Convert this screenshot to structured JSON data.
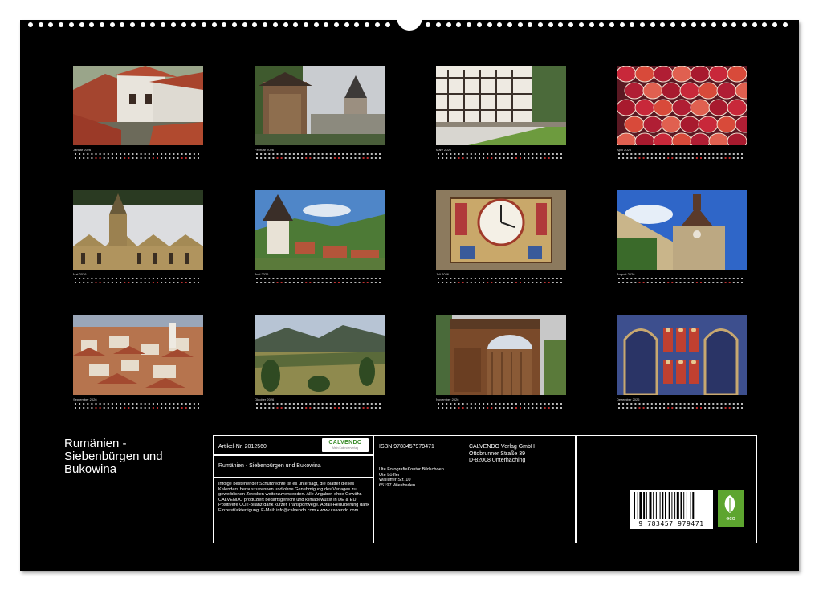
{
  "calendar": {
    "title": "Rumänien - Siebenbürgen und Bukowina",
    "months": [
      {
        "label": "Januar 2026",
        "photo": "castle-courtyard"
      },
      {
        "label": "Februar 2026",
        "photo": "painted-monastery-tower"
      },
      {
        "label": "März 2026",
        "photo": "fortress-galleries"
      },
      {
        "label": "April 2026",
        "photo": "painted-easter-eggs"
      },
      {
        "label": "Mai 2026",
        "photo": "gothic-church"
      },
      {
        "label": "Juni 2026",
        "photo": "village-landscape"
      },
      {
        "label": "Juli 2026",
        "photo": "astronomical-clock"
      },
      {
        "label": "August 2026",
        "photo": "clock-tower-sighisoara"
      },
      {
        "label": "September 2026",
        "photo": "city-rooftops"
      },
      {
        "label": "Oktober 2026",
        "photo": "hills-meadow"
      },
      {
        "label": "November 2026",
        "photo": "wooden-gate"
      },
      {
        "label": "Dezember 2026",
        "photo": "monastery-fresco"
      }
    ]
  },
  "info": {
    "article": "Artikel-Nr. 2012560",
    "publisher_logo": "CALVENDO",
    "publisher_logo_sub": "Mein Kalenderverlag",
    "book_title": "Rumänien - Siebenbürgen und Bukowina",
    "legal_text": "Infolge bestehender Schutzrechte ist es untersagt, die Blätter dieses Kalenders herauszutrennen und ohne Genehmigung des Verlages zu gewerblichen Zwecken weiterzuverwenden. Alle Angaben ohne Gewähr. CALVENDO produziert bedarfsgerecht und klimabewusst in DE & EU. Positivere CO2-Bilanz dank kurzer Transportwege. Abfall-Reduzierung dank Einzelstückfertigung. E-Mail: info@calvendo.com • www.calvendo.com",
    "isbn": "ISBN 9783457979471",
    "author_lines": [
      "Ute FotografieKontor Bildschoen",
      "Ute Löffler",
      "Walluffer Str. 10",
      "65197 Wiesbaden"
    ],
    "publisher_lines": [
      "CALVENDO Verlag GmbH",
      "Ottobrunner Straße 39",
      "D-82008 Unterhaching"
    ],
    "barcode_digits": "9 783457 979471",
    "eco_label": "eco"
  },
  "colors": {
    "board": "#000000",
    "text": "#ffffff",
    "eco": "#5da52f",
    "logo": "#3a8c2a"
  }
}
